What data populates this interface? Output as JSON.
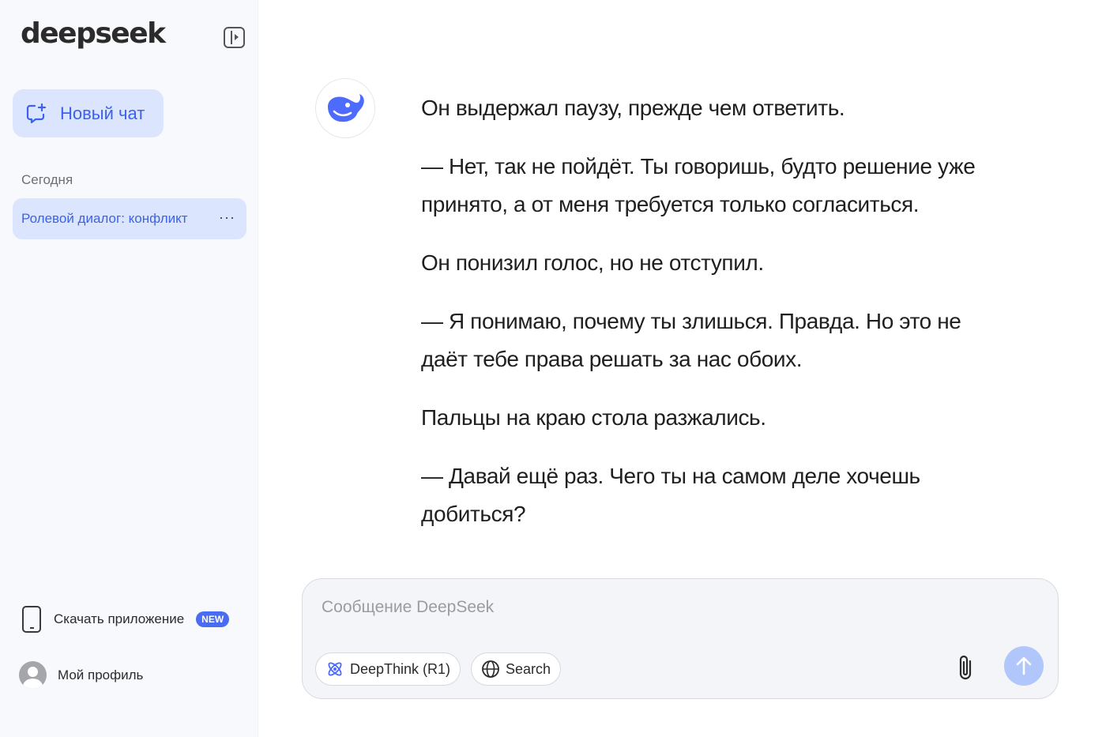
{
  "sidebar": {
    "logo": "deepseek",
    "new_chat_label": "Новый чат",
    "section_today": "Сегодня",
    "history": [
      {
        "label": "Ролевой диалог: конфликт",
        "more": "···"
      }
    ],
    "download_label": "Скачать приложение",
    "new_badge": "NEW",
    "profile_label": "Мой профиль"
  },
  "conversation": {
    "paragraphs": [
      "Он выдержал паузу, прежде чем ответить.",
      "— Нет, так не пойдёт. Ты говоришь, будто решение уже принято, а от меня требуется только согласиться.",
      "Он понизил голос, но не отступил.",
      "— Я понимаю, почему ты злишься. Правда. Но это не даёт тебе права решать за нас обоих.",
      "Пальцы на краю стола разжались.",
      "— Давай ещё раз. Чего ты на самом деле хочешь добиться?"
    ]
  },
  "composer": {
    "placeholder": "Сообщение DeepSeek",
    "value": "",
    "deepthink_label": "DeepThink (R1)",
    "search_label": "Search"
  },
  "colors": {
    "accent": "#4d6bfe",
    "accent_light_bg": "#dbe6fe",
    "send_disabled": "#b1c6fb",
    "sidebar_bg": "#f8f9fc"
  },
  "icons": {
    "collapse": "sidebar-collapse-icon",
    "new_chat": "new-chat-icon",
    "bot": "deepseek-whale-icon",
    "phone": "phone-icon",
    "avatar": "user-avatar-icon",
    "deepthink": "atom-icon",
    "search": "globe-icon",
    "attach": "paperclip-icon",
    "send": "arrow-up-icon"
  }
}
